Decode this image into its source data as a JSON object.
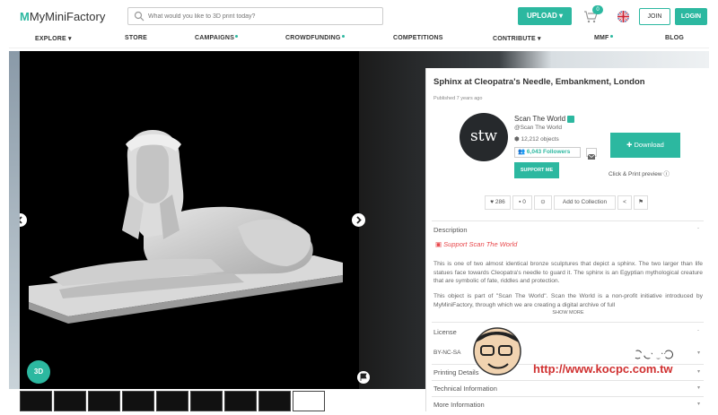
{
  "header": {
    "logo_mark": "M",
    "logo_text": "MyMiniFactory",
    "search_placeholder": "What would you like to 3D print today?",
    "upload_label": "UPLOAD ▾",
    "cart_count": "0",
    "join_label": "JOIN",
    "login_label": "LOGIN"
  },
  "nav": {
    "explore": "EXPLORE ▾",
    "store": "STORE",
    "campaigns": "CAMPAIGNS",
    "crowdfunding": "CROWDFUNDING",
    "competitions": "COMPETITIONS",
    "contribute": "CONTRIBUTE ▾",
    "mmf": "MMF",
    "blog": "BLOG"
  },
  "viewer": {
    "badge_3d": "3D"
  },
  "object": {
    "title": "Sphinx at Cleopatra's Needle, Embankment, London",
    "published": "Published 7 years ago",
    "avatar_text": "stw",
    "author": "Scan The World",
    "handle": "@Scan The World",
    "objects": "12,212 objects",
    "followers": "6,043 Followers",
    "support_label": "SUPPORT ME",
    "download_label": "✚ Download",
    "click_print": "Click & Print preview",
    "likes": "286",
    "comments": "0",
    "add_collection": "Add to Collection"
  },
  "description": {
    "heading": "Description",
    "support_link": "Support Scan The World",
    "para1": "This is one of two almost identical bronze sculptures that depict a sphinx. The two larger than life statues face towards Cleopatra's needle to guard it. The sphinx is an Egyptian mythological creature that are symbolic of fate, riddles and protection.",
    "para2": "This object is part of \"Scan The World\". Scan the World is a non-profit initiative introduced by MyMiniFactory, through which we are creating a digital archive of full",
    "show_more": "SHOW MORE"
  },
  "sections": {
    "license": "License",
    "license_value": "BY-NC-SA",
    "printing": "Printing Details",
    "technical": "Technical Information",
    "more": "More Information"
  },
  "watermark": {
    "cjk": "電腦王阿達",
    "url": "http://www.kocpc.com.tw"
  },
  "colors": {
    "accent": "#2cb8a0",
    "support_link": "#e8474b"
  }
}
